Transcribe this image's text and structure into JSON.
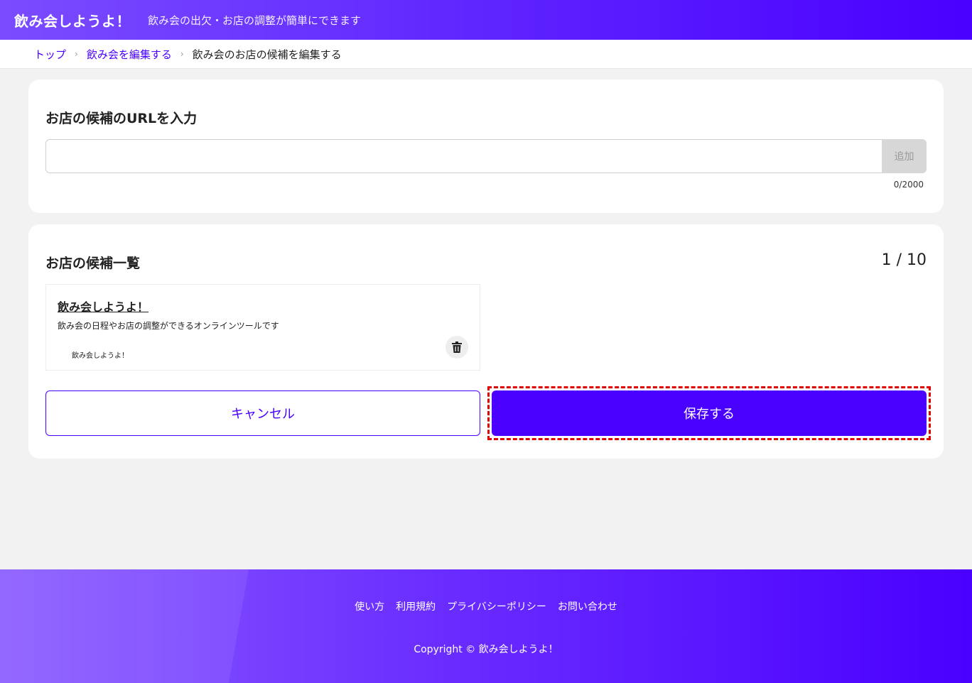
{
  "header": {
    "title": "飲み会しようよ！",
    "subtitle": "飲み会の出欠・お店の調整が簡単にできます"
  },
  "breadcrumb": {
    "items": [
      {
        "label": "トップ"
      },
      {
        "label": "飲み会を編集する"
      },
      {
        "label": "飲み会のお店の候補を編集する"
      }
    ]
  },
  "url_section": {
    "title": "お店の候補のURLを入力",
    "input_value": "",
    "add_label": "追加",
    "counter": "0/2000"
  },
  "list_section": {
    "title": "お店の候補一覧",
    "count": "1 / 10",
    "items": [
      {
        "name": "飲み会しようよ！",
        "description": "飲み会の日程やお店の調整ができるオンラインツールです",
        "site": "飲み会しようよ！"
      }
    ]
  },
  "actions": {
    "cancel_label": "キャンセル",
    "save_label": "保存する"
  },
  "footer": {
    "links": [
      "使い方",
      "利用規約",
      "プライバシーポリシー",
      "お問い合わせ"
    ],
    "copyright": "Copyright © 飲み会しようよ！"
  },
  "colors": {
    "brand": "#4a00ff",
    "highlight": "#e00000"
  },
  "icons": {
    "delete": "trash-icon",
    "separator": "chevron-right-icon"
  }
}
